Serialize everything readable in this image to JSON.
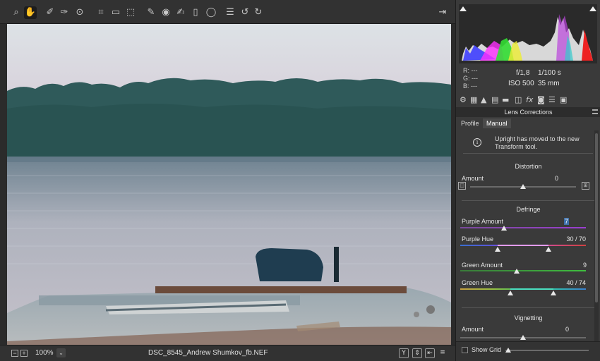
{
  "toolbar": {
    "tools": [
      {
        "name": "zoom-icon",
        "glyph": "⌕"
      },
      {
        "name": "hand-icon",
        "glyph": "✋",
        "active": true
      },
      {
        "name": "white-balance-icon",
        "glyph": "⁄"
      },
      {
        "name": "color-sampler-icon",
        "glyph": "⁄"
      },
      {
        "name": "target-adjustment-icon",
        "glyph": "⊙"
      },
      {
        "name": "crop-icon",
        "glyph": "⌗"
      },
      {
        "name": "straighten-icon",
        "glyph": "▭"
      },
      {
        "name": "transform-icon",
        "glyph": "⬚"
      },
      {
        "name": "spot-removal-icon",
        "glyph": "✎"
      },
      {
        "name": "red-eye-icon",
        "glyph": "◉"
      },
      {
        "name": "adjustment-brush-icon",
        "glyph": "✍"
      },
      {
        "name": "graduated-filter-icon",
        "glyph": "▯"
      },
      {
        "name": "radial-filter-icon",
        "glyph": "◯"
      },
      {
        "name": "list-icon",
        "glyph": "☰"
      },
      {
        "name": "rotate-ccw-icon",
        "glyph": "↺"
      },
      {
        "name": "rotate-cw-icon",
        "glyph": "↻"
      },
      {
        "name": "fullscreen-icon",
        "glyph": "⇥"
      }
    ]
  },
  "bottom": {
    "zoom": "100%",
    "filename": "DSC_8545_Andrew Shumkov_fb.NEF",
    "zoom_out": "−",
    "zoom_in": "+",
    "dropdown": "⌄",
    "icons": [
      "Y",
      "⇕",
      "⇤",
      "≡"
    ]
  },
  "info": {
    "r_label": "R:",
    "r_value": "---",
    "g_label": "G:",
    "g_value": "---",
    "b_label": "B:",
    "b_value": "---",
    "aperture": "f/1,8",
    "shutter": "1/100 s",
    "iso": "ISO 500",
    "focal": "35 mm"
  },
  "panel": {
    "section_title": "Lens Corrections",
    "tabs": [
      "Profile",
      "Manual"
    ],
    "active_tab": "Manual",
    "notice": "Upright has moved to the new Transform tool.",
    "notice_icon": "i",
    "distortion": {
      "title": "Distortion",
      "amount_label": "Amount",
      "amount_value": "0",
      "amount": 0
    },
    "defringe": {
      "title": "Defringe",
      "purple_amount_label": "Purple Amount",
      "purple_amount_value": "7",
      "purple_amount": 7,
      "purple_hue_label": "Purple Hue",
      "purple_hue_value": "30 / 70",
      "purple_hue": [
        30,
        70
      ],
      "green_amount_label": "Green Amount",
      "green_amount_value": "9",
      "green_amount": 9,
      "green_hue_label": "Green Hue",
      "green_hue_value": "40 / 74",
      "green_hue": [
        40,
        74
      ]
    },
    "vignetting": {
      "title": "Vignetting",
      "amount_label": "Amount",
      "amount_value": "0",
      "amount": 0
    },
    "show_grid_label": "Show Grid"
  },
  "colors": {
    "accent": "#3d6fa8",
    "purple": "#9b3fd1",
    "green": "#3fbf3f"
  }
}
